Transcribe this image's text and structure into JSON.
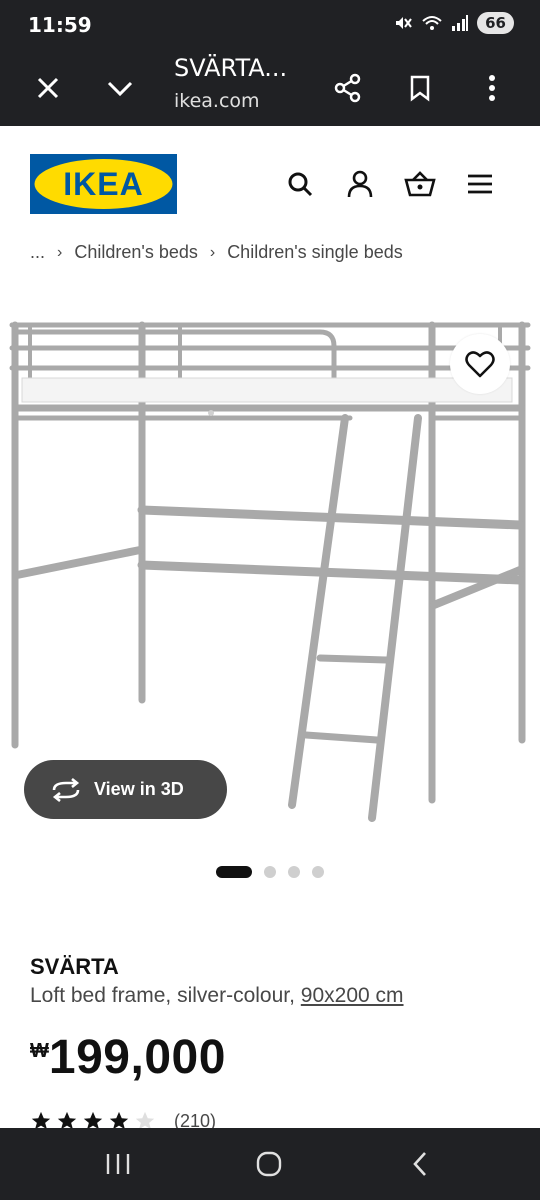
{
  "status_bar": {
    "time": "11:59",
    "battery": "66",
    "icons": [
      "mute-icon",
      "wifi-icon",
      "signal-icon",
      "battery-icon"
    ]
  },
  "browser": {
    "title": "SVÄRTA...",
    "url": "ikea.com",
    "icons": [
      "close-icon",
      "chevron-down-icon",
      "share-icon",
      "bookmark-icon",
      "more-vert-icon"
    ]
  },
  "site_header": {
    "logo_text": "IKEA",
    "logo_colors": {
      "background": "#0058A3",
      "ellipse": "#FFDB00"
    },
    "icons": [
      "search-icon",
      "account-icon",
      "cart-icon",
      "menu-icon"
    ]
  },
  "breadcrumb": {
    "items": [
      "...",
      "Children's beds",
      "Children's single beds"
    ]
  },
  "gallery": {
    "view_3d_label": "View in 3D",
    "slide_count": 4,
    "active_slide": 1
  },
  "product": {
    "name": "SVÄRTA",
    "description": "Loft bed frame, silver-colour, ",
    "size": "90x200 cm",
    "currency_symbol": "₩",
    "price": "199,000",
    "rating_stars": 4,
    "rating_count": "(210)"
  },
  "colors": {
    "dark_bar": "#202124",
    "text_secondary": "#484848",
    "button_3d": "#474747"
  }
}
